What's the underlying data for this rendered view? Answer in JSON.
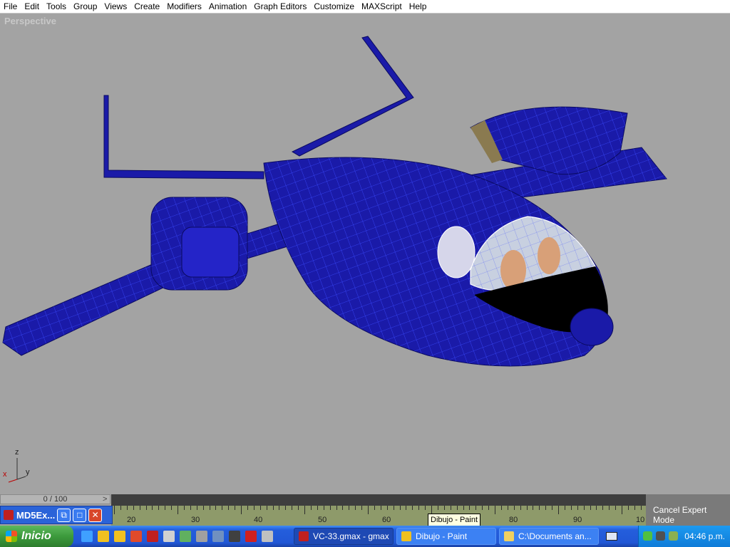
{
  "menu": [
    "File",
    "Edit",
    "Tools",
    "Group",
    "Views",
    "Create",
    "Modifiers",
    "Animation",
    "Graph Editors",
    "Customize",
    "MAXScript",
    "Help"
  ],
  "viewport": {
    "label": "Perspective",
    "axis": {
      "x": "x",
      "y": "y",
      "z": "z"
    }
  },
  "timeline": {
    "frame": "0 / 100",
    "prev": "<",
    "next": ">"
  },
  "ruler": {
    "labels": [
      "20",
      "30",
      "40",
      "50",
      "60",
      "70",
      "80",
      "90",
      "10"
    ]
  },
  "expert": {
    "cancel_label": "Cancel Expert Mode"
  },
  "mini_window": {
    "title": "MD5Ex..."
  },
  "tooltip": {
    "text": "Dibujo - Paint"
  },
  "taskbar": {
    "start_label": "Inicio",
    "tasks": [
      {
        "label": "VC-33.gmax - gmax"
      },
      {
        "label": "Dibujo - Paint"
      },
      {
        "label": "C:\\Documents an..."
      }
    ],
    "clock": "04:46 p.m."
  },
  "colors": {
    "model": "#1a1aa8",
    "viewport": "#a3a3a3",
    "taskbar": "#245edc"
  }
}
